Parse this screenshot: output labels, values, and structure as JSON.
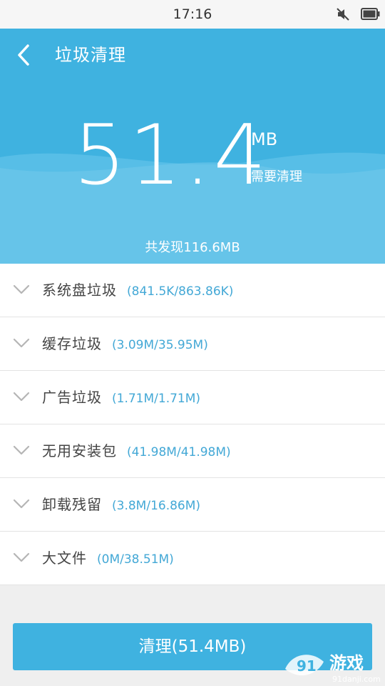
{
  "status_bar": {
    "time": "17:16",
    "icons": [
      "mute-icon",
      "battery-icon"
    ]
  },
  "header": {
    "back_icon": "chevron-left-icon",
    "title": "垃圾清理",
    "amount": "51.4",
    "unit": "MB",
    "subtitle": "需要清理",
    "found_total": "共发现116.6MB"
  },
  "junk_items": [
    {
      "name": "系统盘垃圾",
      "size": "(841.5K/863.86K)"
    },
    {
      "name": "缓存垃圾",
      "size": "(3.09M/35.95M)"
    },
    {
      "name": "广告垃圾",
      "size": "(1.71M/1.71M)"
    },
    {
      "name": "无用安装包",
      "size": "(41.98M/41.98M)"
    },
    {
      "name": "卸载残留",
      "size": "(3.8M/16.86M)"
    },
    {
      "name": "大文件",
      "size": "(0M/38.51M)"
    }
  ],
  "clean_button": {
    "label": "清理(51.4MB)"
  },
  "watermark": {
    "text": "游戏",
    "site": "91danji.com"
  },
  "colors": {
    "primary": "#3fb2e0",
    "size_text": "#43a8d6",
    "item_text": "#444444",
    "background": "#efefef"
  }
}
